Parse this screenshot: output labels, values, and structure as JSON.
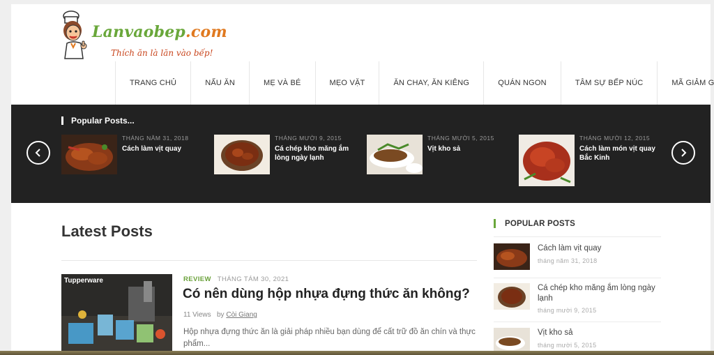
{
  "header": {
    "logo_name": "Lanvaobep",
    "logo_ext": ".com",
    "tagline": "Thích ăn là lăn vào bếp!"
  },
  "nav": {
    "items": [
      {
        "label": "TRANG CHỦ"
      },
      {
        "label": "NẤU ĂN"
      },
      {
        "label": "MẸ VÀ BÉ"
      },
      {
        "label": "MẸO VẶT"
      },
      {
        "label": "ĂN CHAY, ĂN KIÊNG"
      },
      {
        "label": "QUÁN NGON"
      },
      {
        "label": "TÂM SỰ BẾP NÚC"
      },
      {
        "label": "MÃ GIẢM GIÁ"
      }
    ]
  },
  "popular_slider": {
    "heading": "Popular Posts...",
    "prev_icon": "chevron-left-icon",
    "next_icon": "chevron-right-icon",
    "slides": [
      {
        "date": "THÁNG NĂM 31, 2018",
        "title": "Cách làm vịt quay",
        "thumb": "roast-duck"
      },
      {
        "date": "THÁNG MƯỜI 9, 2015",
        "title": "Cá chép kho măng ắm lòng ngày lạnh",
        "thumb": "braised-fish"
      },
      {
        "date": "THÁNG MƯỜI 5, 2015",
        "title": "Vịt kho sả",
        "thumb": "duck-lemongrass"
      },
      {
        "date": "THÁNG MƯỜI 12, 2015",
        "title": "Cách làm món vịt quay Bắc Kinh",
        "thumb": "peking-duck"
      }
    ]
  },
  "latest": {
    "title": "Latest Posts",
    "post": {
      "thumb_label": "Tupperware",
      "category": "REVIEW",
      "date": "THÁNG TÁM 30, 2021",
      "title": "Có nên dùng hộp nhựa đựng thức ăn không?",
      "views": "11 Views",
      "by": "by",
      "author": "Còi Giang",
      "excerpt": "Hộp nhựa đựng thức ăn là giải pháp nhiều bạn dùng để cất trữ đồ ăn chín và thực phẩm..."
    }
  },
  "sidebar": {
    "heading": "POPULAR POSTS",
    "items": [
      {
        "title": "Cách làm vịt quay",
        "date": "tháng năm 31, 2018"
      },
      {
        "title": "Cá chép kho măng ắm lòng ngày lạnh",
        "date": "tháng mười 9, 2015"
      },
      {
        "title": "Vịt kho sả",
        "date": "tháng mười 5, 2015"
      }
    ]
  },
  "colors": {
    "brand_green": "#69a73a",
    "brand_orange": "#e0791f",
    "dark_band": "#222222"
  }
}
